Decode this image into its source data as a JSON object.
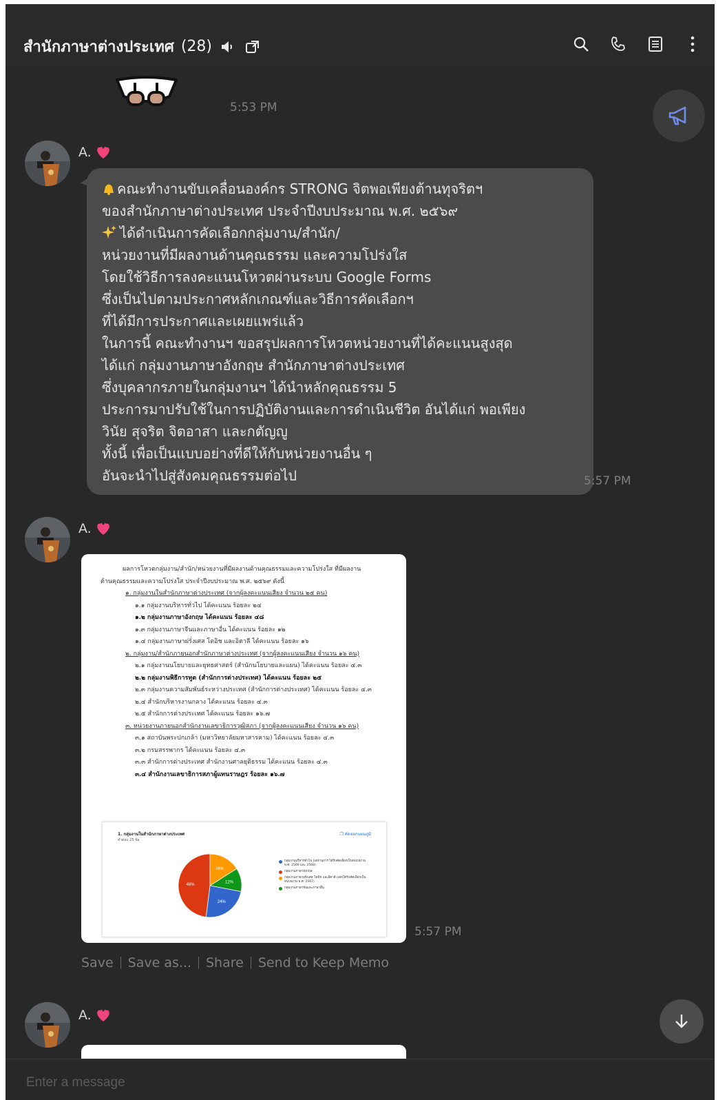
{
  "header": {
    "title": "สำนักภาษาต่างประเทศ",
    "member_count": "(28)"
  },
  "messages": [
    {
      "time": "5:53 PM"
    },
    {
      "sender": "A.",
      "time": "5:57 PM",
      "lines": [
        "คณะทำงานขับเคลื่อนองค์กร STRONG จิตพอเพียงต้านทุจริตฯ",
        "ของสำนักภาษาต่างประเทศ ประจำปีงบประมาณ พ.ศ. ๒๕๖๙",
        "ได้ดำเนินการคัดเลือกกลุ่มงาน/สำนัก/",
        "หน่วยงานที่มีผลงานด้านคุณธรรม และความโปร่งใส",
        "โดยใช้วิธีการลงคะแนนโหวตผ่านระบบ Google Forms",
        "ซึ่งเป็นไปตามประกาศหลักเกณฑ์และวิธีการคัดเลือกฯ",
        "ที่ได้มีการประกาศและเผยแพร่แล้ว",
        "ในการนี้ คณะทำงานฯ ขอสรุปผลการโหวตหน่วยงานที่ได้คะแนนสูงสุด",
        "ได้แก่ กลุ่มงานภาษาอังกฤษ สำนักภาษาต่างประเทศ",
        "ซึ่งบุคลากรภายในกลุ่มงานฯ ได้นำหลักคุณธรรม 5",
        "ประการมาปรับใช้ในการปฏิบัติงานและการดำเนินชีวิต อันได้แก่ พอเพียง",
        "วินัย สุจริต จิตอาสา และกตัญญู",
        "ทั้งนี้ เพื่อเป็นแบบอย่างที่ดีให้กับหน่วยงานอื่น ๆ",
        "อันจะนำไปสู่สังคมคุณธรรมต่อไป"
      ]
    },
    {
      "sender": "A.",
      "time": "5:57 PM",
      "image_doc": {
        "lines": [
          "ผลการโหวตกลุ่มงาน/สำนัก/หน่วยงานที่มีผลงานด้านคุณธรรมและความโปร่งใส ที่มีผลงาน",
          "ด้านคุณธรรมและความโปร่งใส ประจำปีงบประมาณ พ.ศ. ๒๕๖๙ ดังนี้",
          "๑. กลุ่มงานในสำนักภาษาต่างประเทศ (จากผู้ลงคะแนนเสียง จำนวน ๒๕ คน)",
          "๑.๑ กลุ่มงานบริหารทั่วไป ได้คะแนน ร้อยละ ๒๔",
          "๑.๒ กลุ่มงานภาษาอังกฤษ ได้คะแนน ร้อยละ ๔๘",
          "๑.๓ กลุ่มงานภาษาจีนและภาษาอื่น ได้คะแนน ร้อยละ ๑๒",
          "๑.๔ กลุ่มงานภาษาฝรั่งเศส โดอิช และอิตาลี ได้คะแนน ร้อยละ ๑๖",
          "๒. กลุ่มงาน/สำนักภายนอกสำนักภาษาต่างประเทศ (จากผู้ลงคะแนนเสียง จำนวน ๑๖ คน)",
          "๒.๑ กลุ่มงานนโยบายและยุทธศาสตร์ (สำนักนโยบายและแผน) ได้คะแนน ร้อยละ ๔.๓",
          "๒.๒ กลุ่มงานพิธีการทูต (สำนักการต่างประเทศ) ได้คะแนน ร้อยละ ๒๕",
          "๒.๓ กลุ่มงานความสัมพันธ์ระหว่างประเทศ (สำนักการต่างประเทศ) ได้คะแนน ร้อยละ ๔.๓",
          "๒.๔ สำนักบริหารงานกลาง ได้คะแนน ร้อยละ ๔.๓",
          "๒.๕ สำนักการต่างประเทศ ได้คะแนน ร้อยละ ๑๖.๗",
          "๓. หน่วยงานภายนอกสำนักงานเลขาธิการวุฒิสภา (จากผู้ลงคะแนนเสียง จำนวน ๑๖ คน)",
          "๓.๑ สถาบันพระปกเกล้า (มหาวิทยาลัยมหาสารคาม) ได้คะแนน ร้อยละ ๔.๓",
          "๓.๒ กรมสรรพากร ได้คะแนน ร้อยละ ๔.๓",
          "๓.๓ สำนักการต่างประเทศ สำนักงานศาลยุติธรรม ได้คะแนน ร้อยละ ๔.๓",
          "๓.๔ สำนักงานเลขาธิการสภาผู้แทนราษฎร ร้อยละ ๑๖.๗"
        ],
        "chart_title": "1. กลุ่มงานในสำนักภาษาต่างประเทศ",
        "chart_subtitle": "คำตอบ 25 ข้อ",
        "chart_button": "คัดลอกแผนภูมิ",
        "legend": [
          "กลุ่มงานบริหารทั่วไป (เลขานุการ ได้รับคัดเลือกเป็นหน่วยงาน พ.ศ. 2566 และ 2568)",
          "กลุ่มงานภาษาอังกฤษ",
          "กลุ่มงานภาษาฝรั่งเศส โดอิช และอิตาลี (เคยได้รับคัดเลือกเป็นหน่วยงาน พ.ศ. 2567)",
          "กลุ่มงานภาษาจีนและภาษาอื่น"
        ]
      }
    },
    {
      "sender": "A."
    }
  ],
  "image_actions": [
    "Save",
    "Save as...",
    "Share",
    "Send to Keep Memo"
  ],
  "input": {
    "placeholder": "Enter a message"
  },
  "chart_data": {
    "type": "pie",
    "title": "1. กลุ่มงานในสำนักภาษาต่างประเทศ",
    "subtitle": "คำตอบ 25 ข้อ",
    "labels": [
      "กลุ่มงานบริหารทั่วไป (เลขานุการ ได้รับคัดเลือกเป็นหน่วยงาน พ.ศ. 2566 และ 2568)",
      "กลุ่มงานภาษาอังกฤษ",
      "กลุ่มงานภาษาฝรั่งเศส โดอิช และอิตาลี (เคยได้รับคัดเลือกเป็นหน่วยงาน พ.ศ. 2567)",
      "กลุ่มงานภาษาจีนและภาษาอื่น"
    ],
    "values": [
      24,
      48,
      16,
      12
    ],
    "value_labels": [
      "24%",
      "48%",
      "16%",
      "12%"
    ],
    "colors": [
      "#3366cc",
      "#dc3912",
      "#ff9900",
      "#109618"
    ],
    "legend_position": "right"
  }
}
